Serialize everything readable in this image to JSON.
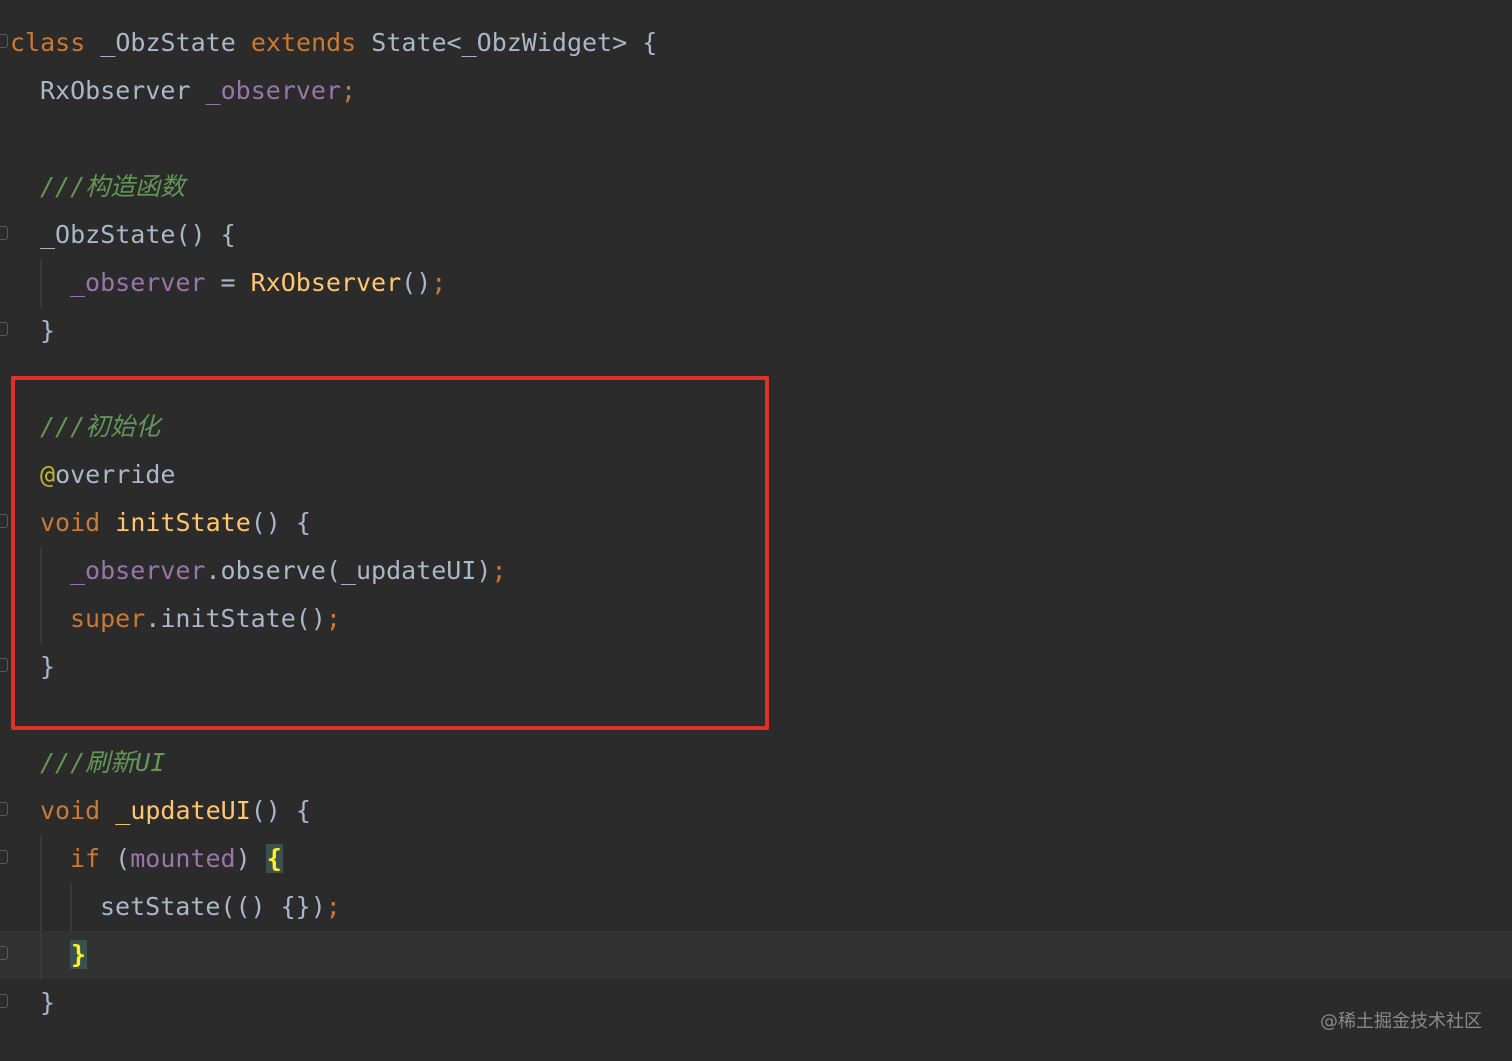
{
  "code": {
    "line1": {
      "kw_class": "class",
      "class_name": "_ObzState",
      "kw_extends": "extends",
      "base": "State<_ObzWidget>",
      "brace": "{"
    },
    "line2": {
      "type": "RxObserver",
      "field": "_observer",
      "semi": ";"
    },
    "line4": {
      "comment": "///构造函数"
    },
    "line5": {
      "ctor": "_ObzState() {"
    },
    "line6": {
      "field": "_observer",
      "op": " = ",
      "call": "RxObserver",
      "parens": "()",
      "semi": ";"
    },
    "line7": {
      "brace": "}"
    },
    "line9": {
      "comment": "///初始化"
    },
    "line10": {
      "at": "@",
      "annotation": "override"
    },
    "line11": {
      "kw_void": "void",
      "method": "initState",
      "rest": "() {"
    },
    "line12": {
      "field": "_observer",
      "call": ".observe(_updateUI)",
      "semi": ";"
    },
    "line13": {
      "kw_super": "super",
      "call": ".initState()",
      "semi": ";"
    },
    "line14": {
      "brace": "}"
    },
    "line16": {
      "comment": "///刷新UI"
    },
    "line17": {
      "kw_void": "void",
      "method": "_updateUI",
      "rest": "() {"
    },
    "line18": {
      "kw_if": "if",
      "open": " (",
      "field": "mounted",
      "close": ") ",
      "brace": "{"
    },
    "line19": {
      "call": "setState(() {})",
      "semi": ";"
    },
    "line20": {
      "brace": "}"
    },
    "line21": {
      "brace": "}"
    }
  },
  "watermark": "@稀土掘金技术社区",
  "colors": {
    "background": "#2b2b2b",
    "keyword": "#cc7832",
    "field": "#9876aa",
    "function": "#ffc66d",
    "comment": "#629755",
    "annotation": "#bbb529",
    "highlight_box": "#e0302a"
  }
}
